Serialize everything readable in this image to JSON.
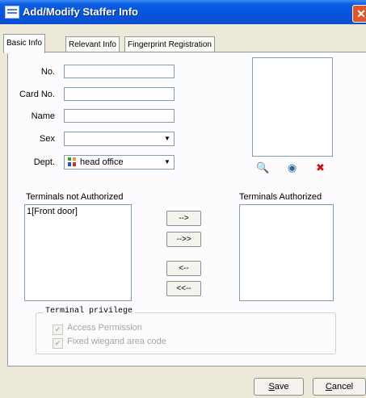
{
  "window": {
    "title": "Add/Modify Staffer Info",
    "close_glyph": "✕"
  },
  "tabs": [
    {
      "label": "Basic Info",
      "active": true
    },
    {
      "label": "Relevant Info",
      "active": false
    },
    {
      "label": "Fingerprint Registration",
      "active": false
    }
  ],
  "form": {
    "no": {
      "label": "No.",
      "value": ""
    },
    "card_no": {
      "label": "Card No.",
      "value": ""
    },
    "name": {
      "label": "Name",
      "value": ""
    },
    "sex": {
      "label": "Sex",
      "value": ""
    },
    "dept": {
      "label": "Dept.",
      "value": "head office"
    }
  },
  "photo_tools": {
    "search_glyph": "🔍",
    "camera_glyph": "◉",
    "delete_glyph": "✖"
  },
  "terminals": {
    "not_authorized_label": "Terminals not Authorized",
    "authorized_label": "Terminals Authorized",
    "not_authorized": [
      "1[Front door]"
    ],
    "authorized": [],
    "buttons": {
      "add_one": "-->",
      "add_all": "-->>",
      "remove_one": "<--",
      "remove_all": "<<--"
    }
  },
  "privilege": {
    "title": "Terminal privilege",
    "access_permission": "Access Permission",
    "fixed_wiegand": "Fixed wiegand area code",
    "check_glyph": "✔"
  },
  "buttons": {
    "save_mnemonic": "S",
    "save_rest": "ave",
    "cancel_mnemonic": "C",
    "cancel_rest": "ancel"
  },
  "colors": {
    "titlebar": "#0554dc",
    "window_bg": "#ece9d8",
    "close": "#e0582a"
  }
}
